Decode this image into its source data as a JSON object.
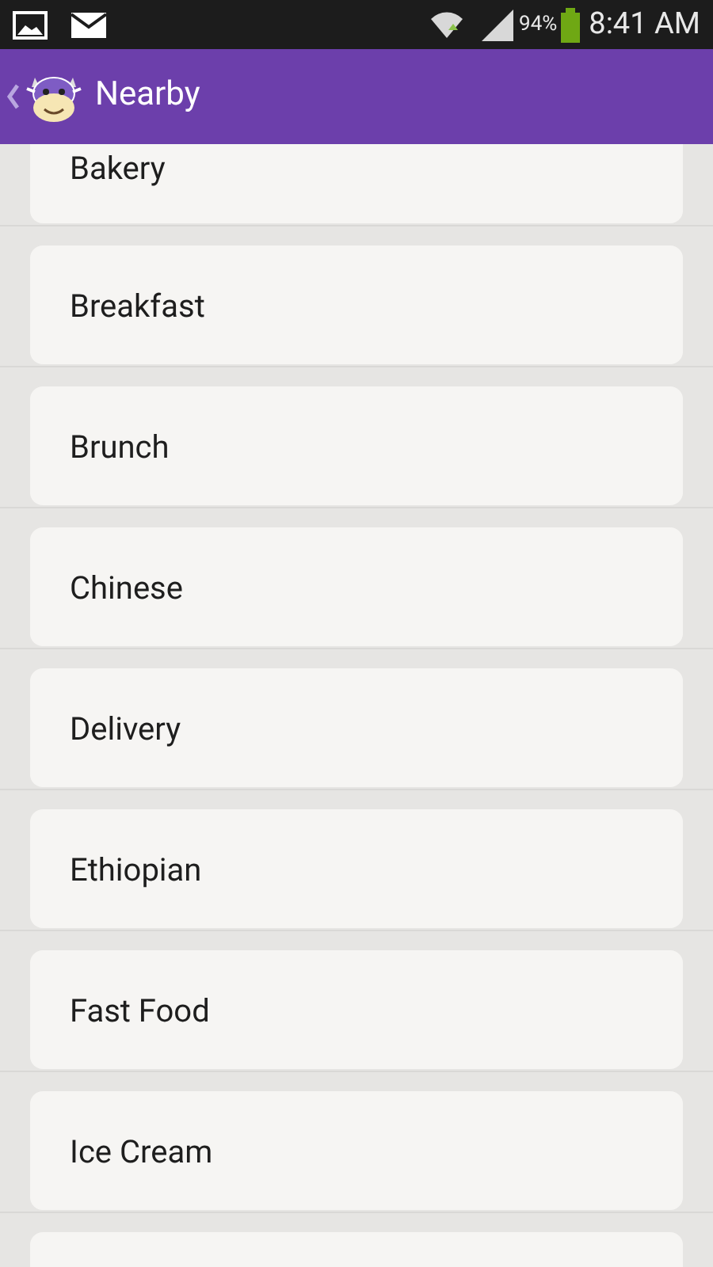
{
  "status_bar": {
    "battery_percent": "94%",
    "time": "8:41 AM"
  },
  "header": {
    "title": "Nearby"
  },
  "categories": [
    {
      "label": "Bakery"
    },
    {
      "label": "Breakfast"
    },
    {
      "label": "Brunch"
    },
    {
      "label": "Chinese"
    },
    {
      "label": "Delivery"
    },
    {
      "label": "Ethiopian"
    },
    {
      "label": "Fast Food"
    },
    {
      "label": "Ice Cream"
    }
  ]
}
